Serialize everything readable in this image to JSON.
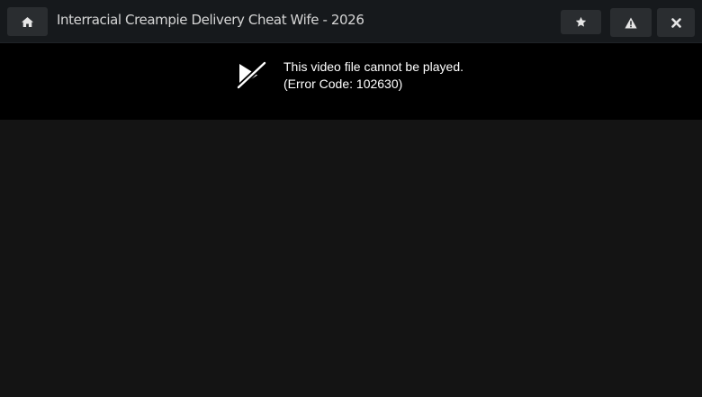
{
  "header": {
    "title": "Interracial Creampie Delivery Cheat Wife - 2026",
    "home_icon": "home-icon",
    "favorite_icon": "star-icon",
    "report_icon": "warning-icon",
    "close_icon": "close-icon"
  },
  "player": {
    "error_icon": "video-slash-icon",
    "error_message": "This video file cannot be played.",
    "error_code": "(Error Code: 102630)"
  },
  "colors": {
    "header_bg": "#16191c",
    "button_bg": "#2a2d30",
    "player_bg": "#000000",
    "page_bg": "#141414"
  }
}
